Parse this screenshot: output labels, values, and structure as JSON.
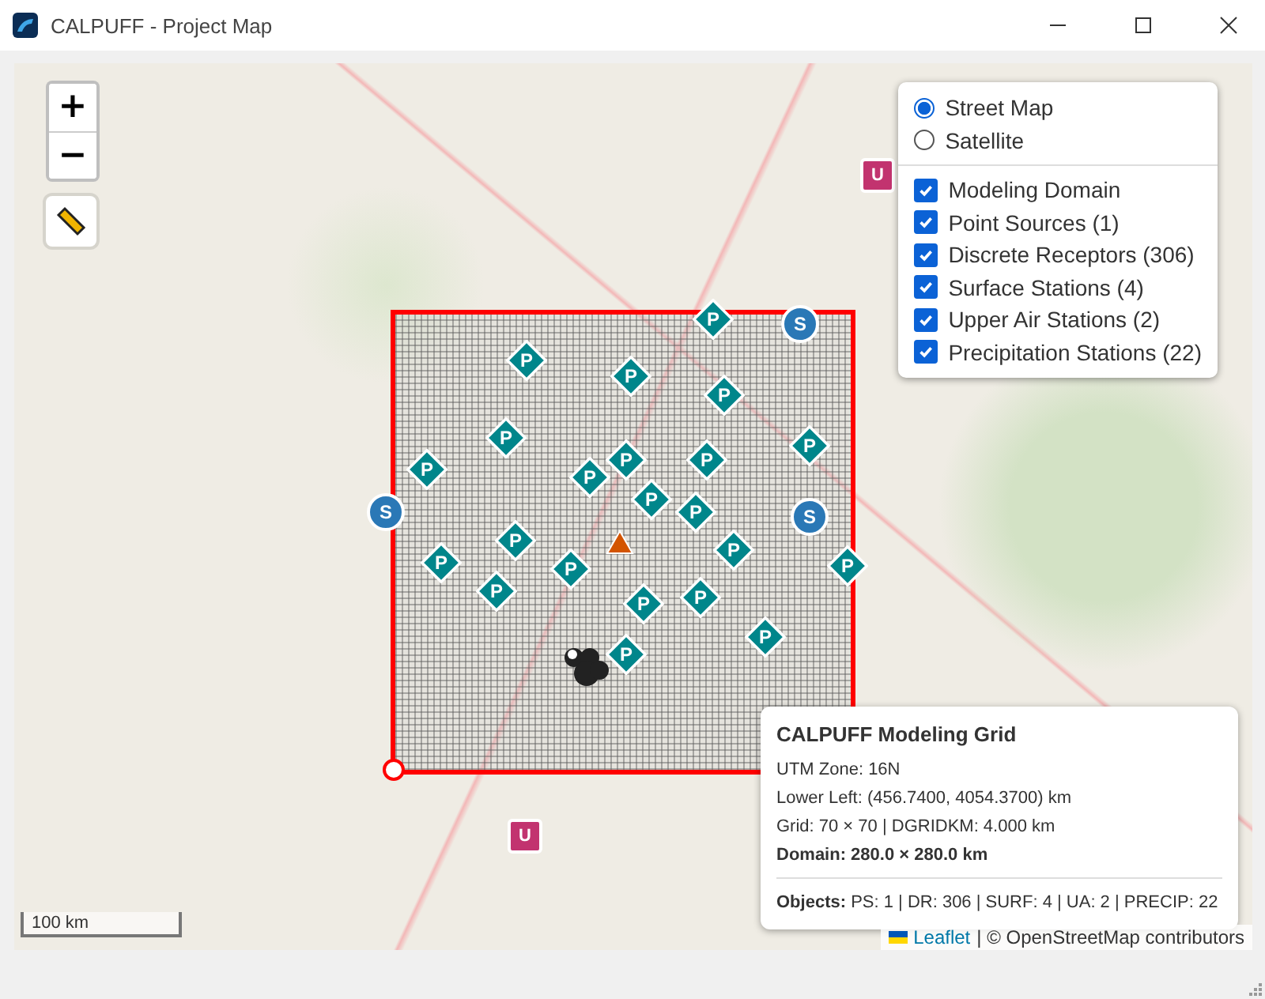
{
  "window": {
    "title": "CALPUFF - Project Map"
  },
  "zoom_controls": [
    "+",
    "−"
  ],
  "layers": {
    "base": [
      {
        "label": "Street Map",
        "selected": true
      },
      {
        "label": "Satellite",
        "selected": false
      }
    ],
    "overlays": [
      {
        "label": "Modeling Domain",
        "checked": true
      },
      {
        "label": "Point Sources (1)",
        "checked": true
      },
      {
        "label": "Discrete Receptors (306)",
        "checked": true
      },
      {
        "label": "Surface Stations (4)",
        "checked": true
      },
      {
        "label": "Upper Air Stations (2)",
        "checked": true
      },
      {
        "label": "Precipitation Stations (22)",
        "checked": true
      }
    ]
  },
  "map": {
    "markers": [
      {
        "kind": "precip",
        "label": "P"
      },
      {
        "kind": "precip",
        "label": "P"
      },
      {
        "kind": "precip",
        "label": "P"
      },
      {
        "kind": "precip",
        "label": "P"
      },
      {
        "kind": "precip",
        "label": "P"
      },
      {
        "kind": "precip",
        "label": "P"
      },
      {
        "kind": "precip",
        "label": "P"
      },
      {
        "kind": "precip",
        "label": "P"
      },
      {
        "kind": "precip",
        "label": "P"
      },
      {
        "kind": "precip",
        "label": "P"
      },
      {
        "kind": "precip",
        "label": "P"
      },
      {
        "kind": "precip",
        "label": "P"
      },
      {
        "kind": "precip",
        "label": "P"
      },
      {
        "kind": "precip",
        "label": "P"
      },
      {
        "kind": "precip",
        "label": "P"
      },
      {
        "kind": "precip",
        "label": "P"
      },
      {
        "kind": "precip",
        "label": "P"
      },
      {
        "kind": "precip",
        "label": "P"
      },
      {
        "kind": "precip",
        "label": "P"
      },
      {
        "kind": "precip",
        "label": "P"
      },
      {
        "kind": "precip",
        "label": "P"
      },
      {
        "kind": "precip",
        "label": "P"
      },
      {
        "kind": "surface",
        "label": "S"
      },
      {
        "kind": "surface",
        "label": "S"
      },
      {
        "kind": "surface",
        "label": "S"
      },
      {
        "kind": "upper_air",
        "label": "U"
      },
      {
        "kind": "upper_air",
        "label": "U"
      },
      {
        "kind": "point_source"
      },
      {
        "kind": "receptors"
      },
      {
        "kind": "origin"
      }
    ],
    "scale": "100 km",
    "attribution": {
      "link": "Leaflet",
      "text": "| © OpenStreetMap contributors"
    }
  },
  "info": {
    "title": "CALPUFF Modeling Grid",
    "lines": [
      {
        "kind": "plain",
        "text": "UTM Zone: 16N"
      },
      {
        "kind": "plain",
        "text": "Lower Left: (456.7400, 4054.3700) km"
      },
      {
        "kind": "plain",
        "text": "Grid: 70 × 70 | DGRIDKM: 4.000 km"
      },
      {
        "kind": "strong",
        "text": "Domain: 280.0 × 280.0 km"
      }
    ],
    "objects": "**Objects:** PS: 1 | DR: 306 | SURF: 4 | UA: 2 | PRECIP: 22"
  }
}
